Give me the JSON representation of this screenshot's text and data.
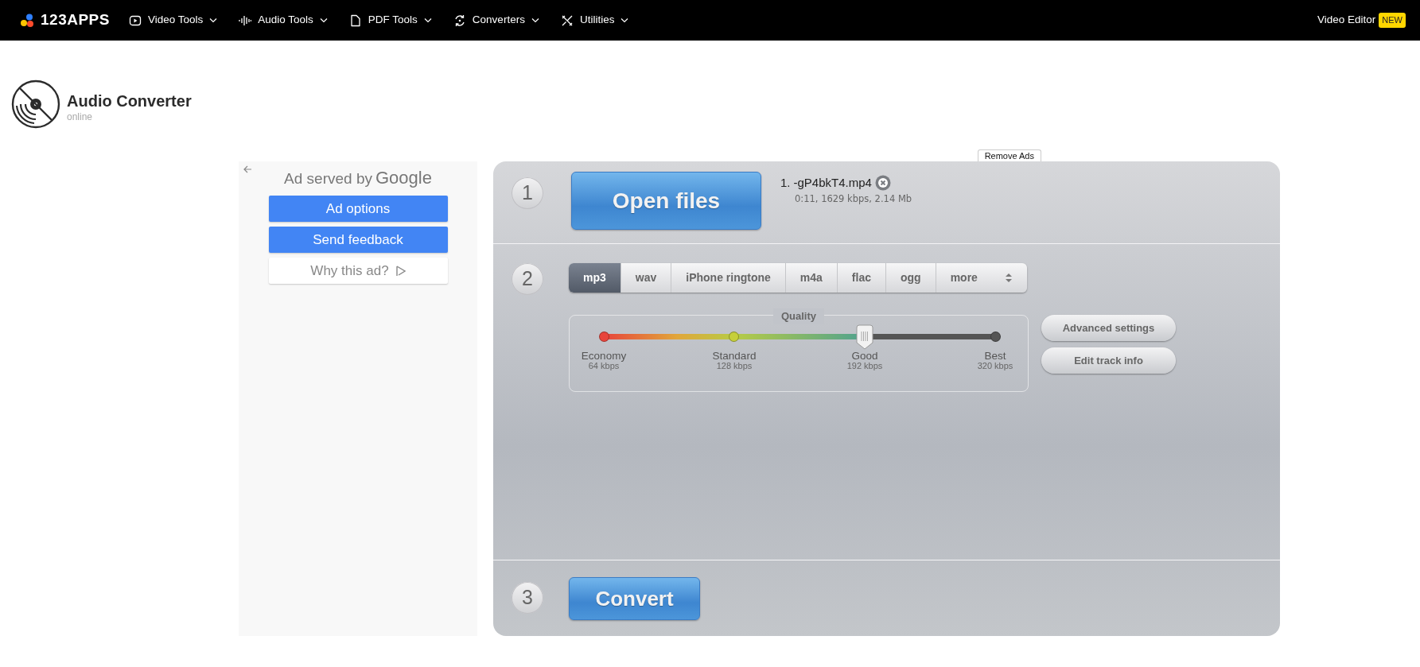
{
  "navbar": {
    "logo": "123APPS",
    "menus": [
      {
        "label": "Video Tools"
      },
      {
        "label": "Audio Tools"
      },
      {
        "label": "PDF Tools"
      },
      {
        "label": "Converters"
      },
      {
        "label": "Utilities"
      }
    ],
    "video_editor": {
      "label": "Video Editor",
      "badge": "NEW"
    }
  },
  "app_header": {
    "title": "Audio Converter",
    "subtitle": "online"
  },
  "ad_panel": {
    "served_by": "Ad served by",
    "brand": "Google",
    "buttons": [
      {
        "label": "Ad options",
        "kind": "primary"
      },
      {
        "label": "Send feedback",
        "kind": "primary"
      },
      {
        "label": "Why this ad?",
        "kind": "plain"
      }
    ]
  },
  "remove_ads": "Remove Ads",
  "step1": {
    "number": "1",
    "button": "Open files",
    "files": [
      {
        "index": "1.",
        "name": "-gP4bkT4.mp4",
        "info": "0:11, 1629 kbps, 2.14 Mb"
      }
    ]
  },
  "step2": {
    "number": "2",
    "formats": [
      {
        "label": "mp3",
        "selected": true
      },
      {
        "label": "wav",
        "selected": false
      },
      {
        "label": "iPhone ringtone",
        "selected": false
      },
      {
        "label": "m4a",
        "selected": false
      },
      {
        "label": "flac",
        "selected": false
      },
      {
        "label": "ogg",
        "selected": false
      },
      {
        "label": "more",
        "selected": false
      }
    ],
    "quality": {
      "label": "Quality",
      "level": 0.667,
      "stops": [
        {
          "name": "Economy",
          "bitrate": "64 kbps"
        },
        {
          "name": "Standard",
          "bitrate": "128 kbps"
        },
        {
          "name": "Good",
          "bitrate": "192 kbps"
        },
        {
          "name": "Best",
          "bitrate": "320 kbps"
        }
      ]
    },
    "buttons": [
      "Advanced settings",
      "Edit track info"
    ]
  },
  "step3": {
    "number": "3",
    "button": "Convert"
  }
}
